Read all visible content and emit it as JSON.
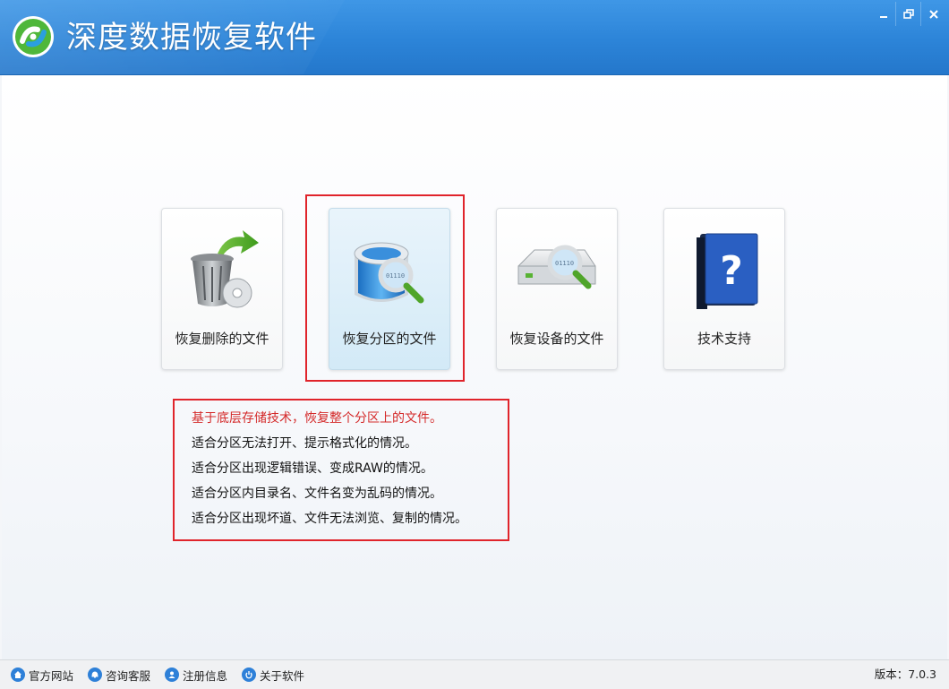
{
  "app": {
    "title": "深度数据恢复软件",
    "accent": "#2c84d8"
  },
  "window": {
    "buttons": [
      {
        "name": "minimize-icon"
      },
      {
        "name": "restore-icon"
      },
      {
        "name": "close-icon"
      }
    ]
  },
  "cards": [
    {
      "label": "恢复删除的文件",
      "icon": "recycle-bin-icon"
    },
    {
      "label": "恢复分区的文件",
      "icon": "partition-search-icon",
      "selected": true
    },
    {
      "label": "恢复设备的文件",
      "icon": "device-search-icon"
    },
    {
      "label": "技术支持",
      "icon": "help-book-icon"
    }
  ],
  "description": {
    "highlight_color": "#e0242b",
    "lines": [
      "基于底层存储技术，恢复整个分区上的文件。",
      "适合分区无法打开、提示格式化的情况。",
      "适合分区出现逻辑错误、变成RAW的情况。",
      "适合分区内目录名、文件名变为乱码的情况。",
      "适合分区出现坏道、文件无法浏览、复制的情况。"
    ]
  },
  "statusbar": {
    "links": [
      {
        "label": "官方网站",
        "icon": "home-icon"
      },
      {
        "label": "咨询客服",
        "icon": "bell-icon"
      },
      {
        "label": "注册信息",
        "icon": "user-icon"
      },
      {
        "label": "关于软件",
        "icon": "power-icon"
      }
    ],
    "version": "版本：7.0.3"
  }
}
